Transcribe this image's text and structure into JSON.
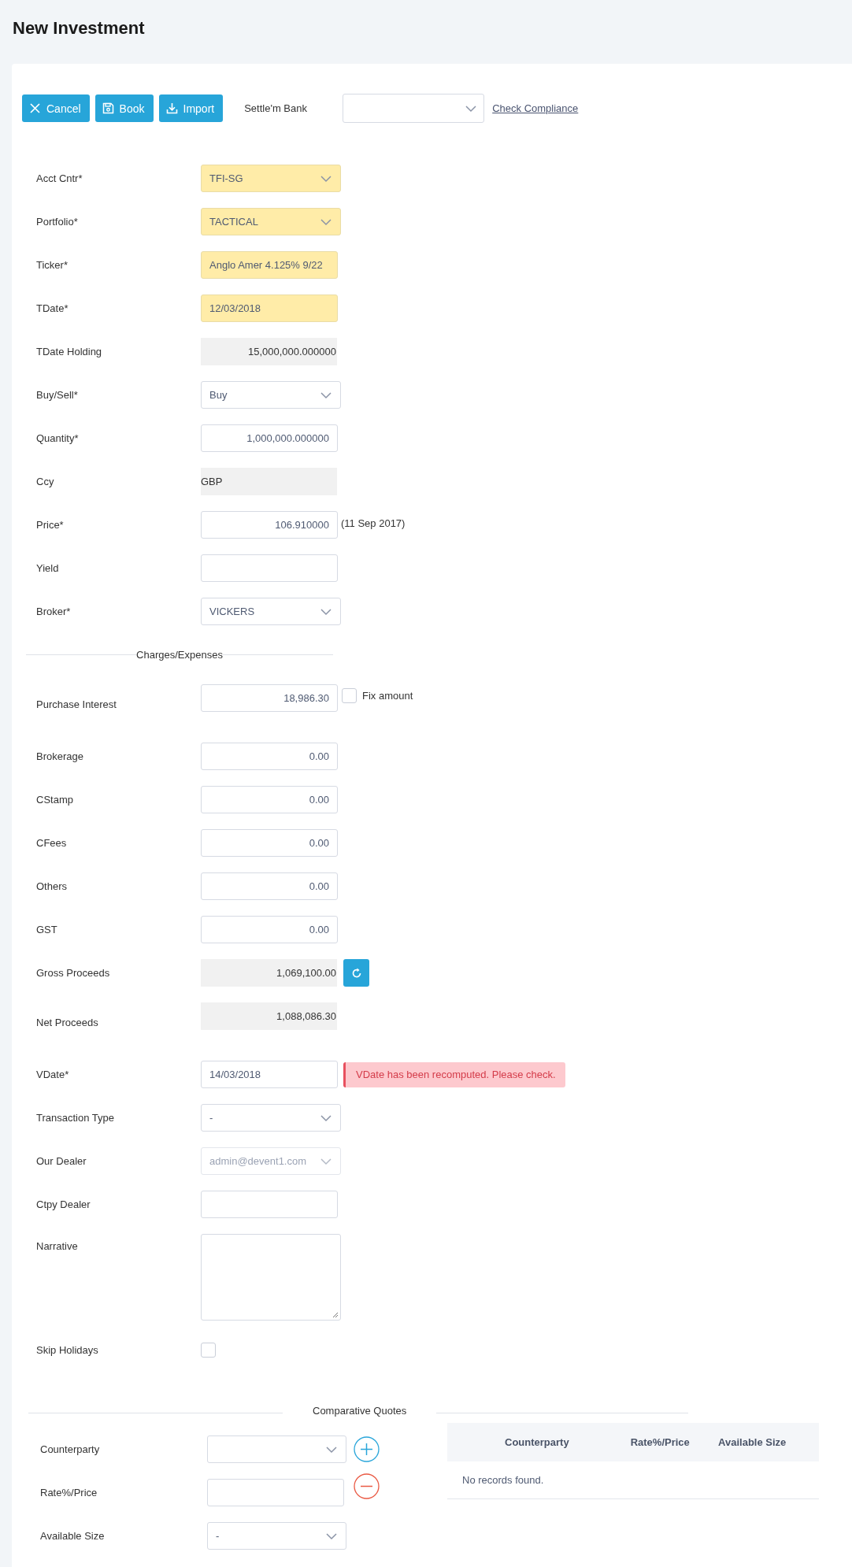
{
  "title": "New Investment",
  "toolbar": {
    "buttons": [
      {
        "label": "Cancel",
        "kind": "cancel"
      },
      {
        "label": "Book",
        "kind": "save"
      },
      {
        "label": "Import",
        "kind": "import"
      }
    ],
    "settle_bank_label": "Settle'm Bank",
    "compliance_link": "Check Compliance"
  },
  "fields": [
    {
      "kind": "select",
      "label": "Acct Cntr*",
      "value": "TFI-SG",
      "highlighted": true,
      "disabled": false
    },
    {
      "kind": "select",
      "label": "Portfolio*",
      "value": "TACTICAL",
      "highlighted": true,
      "disabled": false
    },
    {
      "kind": "input",
      "label": "Ticker*",
      "value": "Anglo Amer 4.125% 9/22",
      "highlighted": true,
      "disabled": false
    },
    {
      "kind": "input",
      "label": "TDate*",
      "value": "12/03/2018",
      "highlighted": true,
      "disabled": false
    },
    {
      "kind": "readonly",
      "label": "TDate Holding",
      "value": "15,000,000.000000",
      "numeric": true
    },
    {
      "kind": "select",
      "label": "Buy/Sell*",
      "value": "Buy",
      "highlighted": false,
      "disabled": false
    },
    {
      "kind": "input",
      "label": "Quantity*",
      "value": "1,000,000.000000",
      "numeric": true,
      "highlighted": false,
      "disabled": false
    },
    {
      "kind": "readonly",
      "label": "Ccy",
      "value": "GBP",
      "numeric": false
    },
    {
      "kind": "input",
      "label": "Price*",
      "value": "106.910000",
      "numeric": true,
      "highlighted": false,
      "disabled": false,
      "note": "(11 Sep 2017)"
    },
    {
      "kind": "input",
      "label": "Yield",
      "highlighted": false,
      "disabled": false
    },
    {
      "kind": "select",
      "label": "Broker*",
      "value": "VICKERS",
      "highlighted": false,
      "disabled": false
    },
    {
      "kind": "section",
      "label": "Charges/Expenses"
    },
    {
      "kind": "input",
      "label": "Purchase Interest",
      "value": "18,986.30",
      "numeric": true,
      "highlighted": false,
      "disabled": false,
      "checkbox": {
        "label": "Fix amount",
        "checked": false
      }
    },
    {
      "kind": "input",
      "label": "Brokerage",
      "value": "0.00",
      "numeric": true,
      "highlighted": false,
      "disabled": false
    },
    {
      "kind": "input",
      "label": "CStamp",
      "value": "0.00",
      "numeric": true,
      "highlighted": false,
      "disabled": false
    },
    {
      "kind": "input",
      "label": "CFees",
      "value": "0.00",
      "numeric": true,
      "highlighted": false,
      "disabled": false
    },
    {
      "kind": "input",
      "label": "Others",
      "value": "0.00",
      "numeric": true,
      "highlighted": false,
      "disabled": false
    },
    {
      "kind": "input",
      "label": "GST",
      "value": "0.00",
      "numeric": true,
      "highlighted": false,
      "disabled": false
    },
    {
      "kind": "readonly",
      "label": "Gross Proceeds",
      "value": "1,069,100.00",
      "numeric": true,
      "refresh_button": true
    },
    {
      "kind": "readonly",
      "label": "Net Proceeds",
      "value": "1,088,086.30",
      "numeric": true
    },
    {
      "kind": "input",
      "label": "VDate*",
      "value": "14/03/2018",
      "highlighted": false,
      "disabled": false,
      "alert": "VDate has been recomputed. Please check."
    },
    {
      "kind": "select",
      "label": "Transaction Type",
      "value": "-",
      "highlighted": false,
      "disabled": false
    },
    {
      "kind": "select",
      "label": "Our Dealer",
      "value": "admin@devent1.com",
      "highlighted": false,
      "disabled": true
    },
    {
      "kind": "input",
      "label": "Ctpy Dealer",
      "highlighted": false,
      "disabled": false
    },
    {
      "kind": "textarea",
      "label": "Narrative",
      "highlighted": false,
      "disabled": false
    },
    {
      "kind": "checkbox",
      "label": "Skip Holidays",
      "checked": false
    }
  ],
  "quotes": {
    "title": "Comparative Quotes",
    "fields": [
      {
        "kind": "select",
        "label": "Counterparty"
      },
      {
        "kind": "input",
        "label": "Rate%/Price"
      },
      {
        "kind": "select",
        "label": "Available Size",
        "value": "-"
      }
    ],
    "table": {
      "columns": [
        "Counterparty",
        "Rate%/Price",
        "Available Size"
      ],
      "empty_message": "No records found."
    }
  }
}
